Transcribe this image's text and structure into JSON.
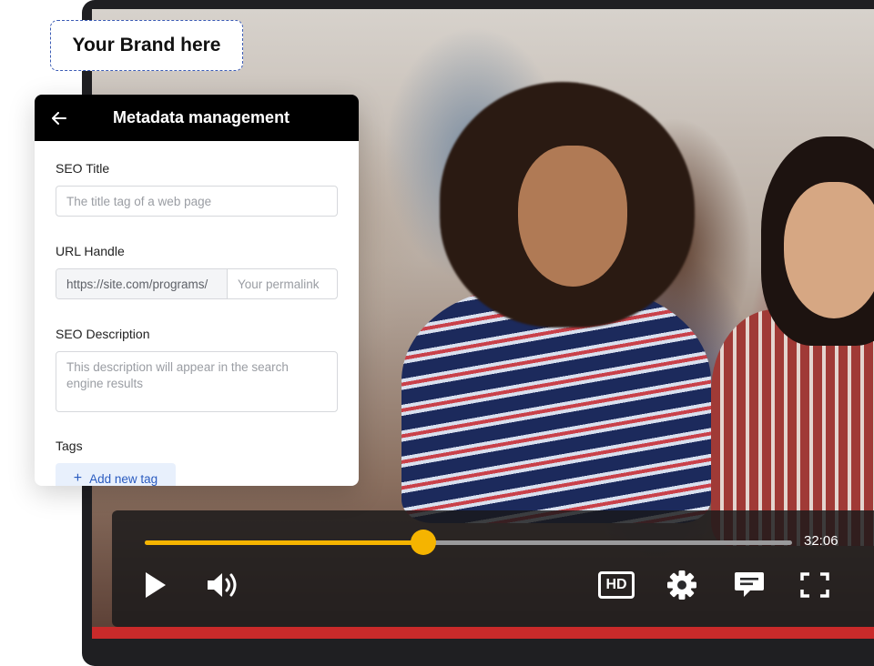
{
  "brand": {
    "label": "Your Brand here"
  },
  "panel": {
    "title": "Metadata management",
    "seo_title": {
      "label": "SEO Title",
      "placeholder": "The title tag of a web page"
    },
    "url_handle": {
      "label": "URL Handle",
      "prefix": "https://site.com/programs/",
      "placeholder": "Your permalink"
    },
    "seo_description": {
      "label": "SEO Description",
      "placeholder": "This description will appear in the search engine results"
    },
    "tags": {
      "label": "Tags",
      "add_label": "Add new tag"
    }
  },
  "player": {
    "progress_fraction": 0.43,
    "duration": "32:06",
    "hd_label": "HD",
    "accent_color": "#f5b400"
  },
  "icons": [
    "back-arrow-icon",
    "plus-icon",
    "play-icon",
    "volume-icon",
    "hd-icon",
    "settings-gear-icon",
    "captions-icon",
    "fullscreen-icon"
  ]
}
